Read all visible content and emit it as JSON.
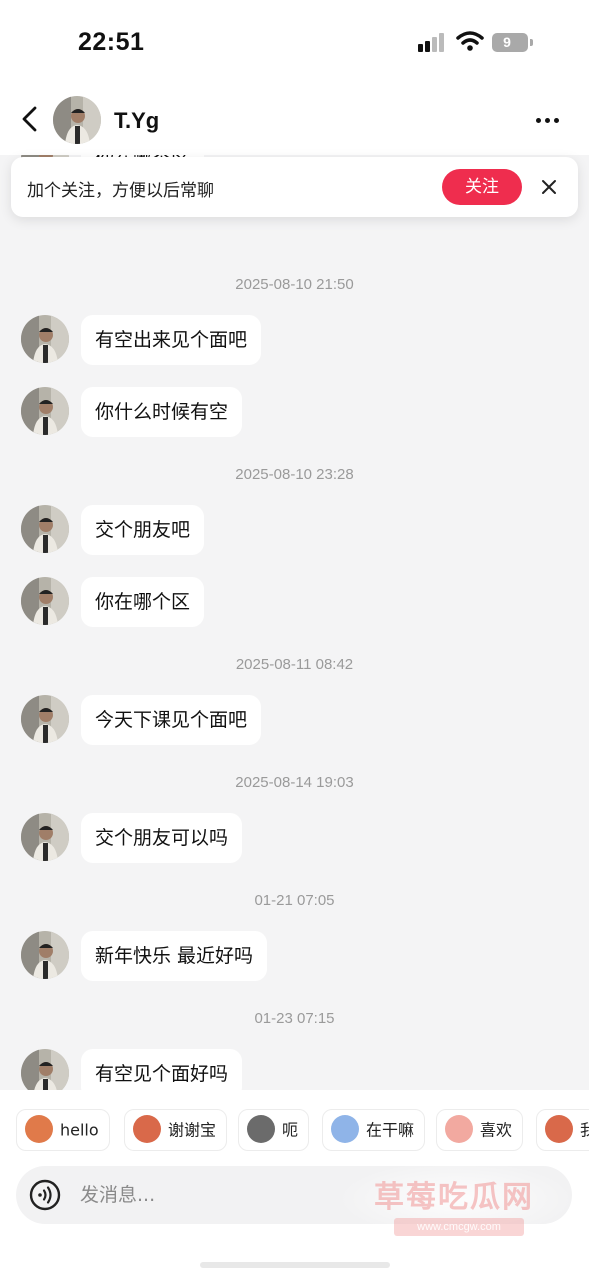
{
  "status_bar": {
    "time": "22:51",
    "battery": "9"
  },
  "header": {
    "name": "T.Yg"
  },
  "follow_banner": {
    "text": "加个关注，方便以后常聊",
    "button_label": "关注"
  },
  "messages": [
    {
      "type": "message",
      "text": "你在哪个区"
    },
    {
      "type": "timestamp",
      "text": "2025-08-10 21:50"
    },
    {
      "type": "message",
      "text": "有空出来见个面吧"
    },
    {
      "type": "message",
      "text": "你什么时候有空"
    },
    {
      "type": "timestamp",
      "text": "2025-08-10 23:28"
    },
    {
      "type": "message",
      "text": "交个朋友吧"
    },
    {
      "type": "message",
      "text": "你在哪个区"
    },
    {
      "type": "timestamp",
      "text": "2025-08-11 08:42"
    },
    {
      "type": "message",
      "text": "今天下课见个面吧"
    },
    {
      "type": "timestamp",
      "text": "2025-08-14 19:03"
    },
    {
      "type": "message",
      "text": "交个朋友可以吗"
    },
    {
      "type": "timestamp",
      "text": "01-21 07:05"
    },
    {
      "type": "message",
      "text": "新年快乐 最近好吗"
    },
    {
      "type": "timestamp",
      "text": "01-23 07:15"
    },
    {
      "type": "message",
      "text": "有空见个面好吗"
    }
  ],
  "stickers": [
    {
      "label": "hello",
      "icon": "monkey-hello-icon",
      "color": "#e07a4a"
    },
    {
      "label": "谢谢宝",
      "icon": "monkey-thanks-icon",
      "color": "#d9694a"
    },
    {
      "label": "呃",
      "icon": "cat-icon",
      "color": "#6b6b6b"
    },
    {
      "label": "在干嘛",
      "icon": "ghost-icon",
      "color": "#8fb4e8"
    },
    {
      "label": "喜欢",
      "icon": "pig-like-icon",
      "color": "#f2a9a0"
    },
    {
      "label": "我",
      "icon": "monkey-icon",
      "color": "#d9694a"
    }
  ],
  "input": {
    "placeholder": "发消息..."
  },
  "watermark": {
    "text": "草莓吃瓜网",
    "url": "www.cmcgw.com"
  },
  "colors": {
    "accent": "#ef2d4e",
    "chat_background": "#f4f4f5",
    "timestamp": "#9a9a9a"
  }
}
